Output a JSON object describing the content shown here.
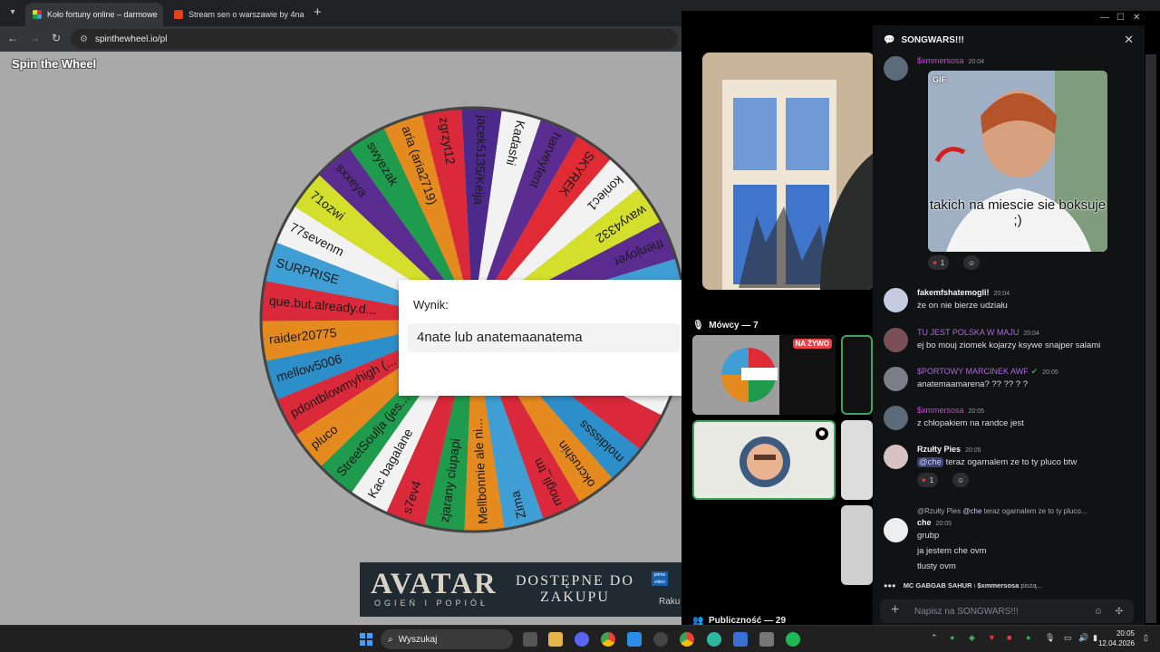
{
  "browser": {
    "tabs": [
      {
        "title": "Koło fortuny online – darmowe"
      },
      {
        "title": "Stream sen o warszawie by 4na"
      }
    ],
    "url": "spinthewheel.io/pl"
  },
  "page": {
    "logo": "Spin the Wheel",
    "wheel_segments": [
      {
        "label": "zgrzyt12",
        "color": "#d9293a"
      },
      {
        "label": "jacek5135/Keija",
        "color": "#4b2a8c"
      },
      {
        "label": "Kadashi",
        "color": "#f2f2f2"
      },
      {
        "label": "harveyfent",
        "color": "#5b2d91"
      },
      {
        "label": "SKYREK",
        "color": "#e02a34"
      },
      {
        "label": "koniec1",
        "color": "#f2f2f2"
      },
      {
        "label": "wavy4332",
        "color": "#d4df2c"
      },
      {
        "label": "thenjoyer",
        "color": "#5a2c90"
      },
      {
        "label": "",
        "color": "#3f9ed3"
      },
      {
        "label": "",
        "color": "#e48a1f"
      },
      {
        "label": "",
        "color": "#1e9b4c"
      },
      {
        "label": "",
        "color": "#f2f2f2"
      },
      {
        "label": "",
        "color": "#d9293a"
      },
      {
        "label": "moldissss",
        "color": "#2c8fc9"
      },
      {
        "label": "okcrushin",
        "color": "#e48a1f"
      },
      {
        "label": "mogli_tm",
        "color": "#d9293a"
      },
      {
        "label": "Zima",
        "color": "#3f9ed3"
      },
      {
        "label": "Mellbonnie ale ni...",
        "color": "#e48a1f"
      },
      {
        "label": "zjarany ciupapi",
        "color": "#1e9b4c"
      },
      {
        "label": "s7ev4",
        "color": "#d9293a"
      },
      {
        "label": "Kac bagalane",
        "color": "#f2f2f2"
      },
      {
        "label": "StreetSoulja (jes...",
        "color": "#1e9b4c"
      },
      {
        "label": "pluco",
        "color": "#e48a1f"
      },
      {
        "label": "pdontblowmyhigh (...",
        "color": "#d9293a"
      },
      {
        "label": "mellow5006",
        "color": "#2c8fc9"
      },
      {
        "label": "raider20775",
        "color": "#e48a1f"
      },
      {
        "label": "que.but.already.d...",
        "color": "#d9293a"
      },
      {
        "label": "SURPRISE",
        "color": "#3f9ed3"
      },
      {
        "label": "77sevenm",
        "color": "#f2f2f2"
      },
      {
        "label": "71ozwi",
        "color": "#d4df2c"
      },
      {
        "label": "sxxeya",
        "color": "#5a2c90"
      },
      {
        "label": "swyezak",
        "color": "#1e9b4c"
      },
      {
        "label": "aria (aria2719)",
        "color": "#e48a1f"
      }
    ],
    "result_label": "Wynik:",
    "result_value": "4nate lub anatemaanatema"
  },
  "ad": {
    "title": "AVATAR",
    "subtitle": "OGIEŃ I POPIÓŁ",
    "cta_line1": "DOSTĘPNE DO",
    "cta_line2": "ZAKUPU",
    "store": "Raku"
  },
  "discord": {
    "speakers_label": "Mówcy — 7",
    "live_badge": "NA ŻYWO",
    "audience_label": "Publiczność — 29",
    "channel_name": "SONGWARS!!!",
    "messages": [
      {
        "user": "$xmmersosa",
        "time": "20:04",
        "color": "#c64bd6",
        "gif_caption": "takich na miescie sie boksuje ;)",
        "gif_tag": "GIF",
        "reaction_count": "1"
      },
      {
        "user": "fakemfshatemogli!",
        "time": "20:04",
        "color": "#f2f3f5",
        "text": "że on nie bierze udziału"
      },
      {
        "user": "TU JEST POLSKA W MAJU",
        "time": "20:04",
        "color": "#a86bd6",
        "text": "ej bo mouj ziomek kojarzy ksywe snajper salami"
      },
      {
        "user": "$PORTOWY MARCINEK AWF",
        "time": "20:05",
        "color": "#a86bd6",
        "text": "anatemaamarena? ?? ?? ? ?"
      },
      {
        "user": "$xmmersosa",
        "time": "20:05",
        "color": "#c64bd6",
        "text": "z chłopakiem na randce jest"
      },
      {
        "user": "Rzułty Pies",
        "time": "20:05",
        "color": "#f2f3f5",
        "mention": "@che",
        "text": " teraz ogarnalem ze to ty pluco btw",
        "reaction_count": "1"
      },
      {
        "user": "che",
        "time": "20:05",
        "color": "#f2f3f5",
        "reply_to": "@Rzułty Pies",
        "reply_mention": "@che",
        "reply_text": " teraz ogarnalem ze to ty pluco...",
        "lines": [
          "grubp",
          "ja jestem che ovm",
          "tlusty ovm"
        ]
      }
    ],
    "typing_users": "MC GABGAB SAHUR",
    "typing_users2": "$xmmersosa",
    "typing_suffix": "piszą...",
    "input_placeholder": "Napisz na SONGWARS!!!"
  },
  "taskbar": {
    "search_placeholder": "Wyszukaj",
    "time": "20:05",
    "date": "12.04.2026"
  }
}
